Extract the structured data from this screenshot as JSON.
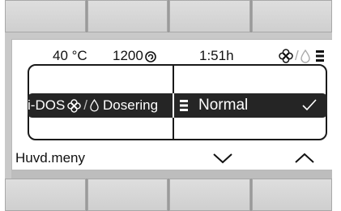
{
  "status": {
    "temperature": "40 °C",
    "spin_speed": "1200",
    "time_remaining": "1:51h",
    "option_separator": "/"
  },
  "selector": {
    "option_label_prefix": "i-DOS",
    "option_separator": "/",
    "option_label_suffix": "Dosering",
    "current_value": "Normal"
  },
  "footer": {
    "main_menu_label": "Huvd.meny"
  },
  "icons": {
    "spin": "spin-icon",
    "fan": "fan-icon",
    "drop": "drop-icon",
    "level_bars": "level-bars-icon",
    "check": "check-icon",
    "down": "chevron-down-icon",
    "up": "chevron-up-icon"
  },
  "colors": {
    "selection_background": "#252525",
    "display_background": "#ffffff",
    "bezel": "#c9c9c9"
  }
}
